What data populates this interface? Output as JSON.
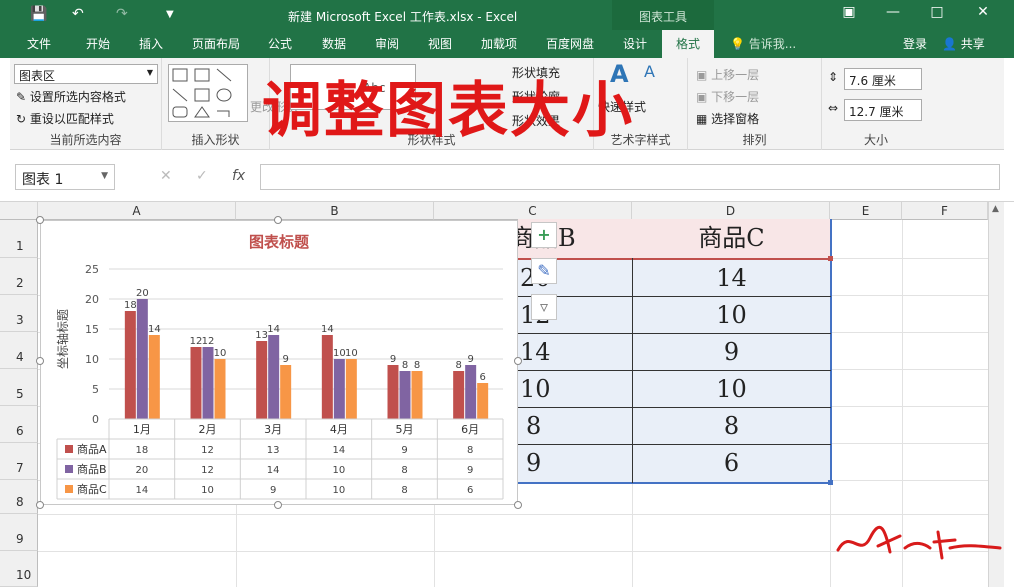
{
  "titlebar": {
    "title": "新建 Microsoft Excel 工作表.xlsx - Excel",
    "context_tab": "图表工具",
    "save_icon": "save-icon",
    "undo_icon": "undo-icon",
    "redo_icon": "redo-icon"
  },
  "tabs": [
    {
      "label": "文件"
    },
    {
      "label": "开始"
    },
    {
      "label": "插入"
    },
    {
      "label": "页面布局"
    },
    {
      "label": "公式"
    },
    {
      "label": "数据"
    },
    {
      "label": "审阅"
    },
    {
      "label": "视图"
    },
    {
      "label": "加载项"
    },
    {
      "label": "百度网盘"
    },
    {
      "label": "设计"
    },
    {
      "label": "格式"
    }
  ],
  "tell_me": "告诉我...",
  "login": "登录",
  "share": "共享",
  "ribbon": {
    "current_selection": {
      "combo_value": "图表区",
      "format_selection": "设置所选内容格式",
      "reset_style": "重设以匹配样式",
      "label": "当前所选内容"
    },
    "insert_shapes": {
      "label": "插入形状",
      "change_shape": "更改形状"
    },
    "shape_styles": {
      "label": "形状样式",
      "fill": "形状填充",
      "outline": "形状轮廓",
      "effects": "形状效果",
      "sample": "Abc"
    },
    "art_styles": {
      "label": "艺术字样式",
      "quick": "快速样式"
    },
    "arrange": {
      "label": "排列",
      "bring_forward": "上移一层",
      "send_backward": "下移一层",
      "selection_pane": "选择窗格"
    },
    "size": {
      "label": "大小",
      "height": "7.6 厘米",
      "width": "12.7 厘米"
    }
  },
  "formula_bar": {
    "name_box": "图表 1",
    "fx": "fx",
    "cancel": "✕",
    "enter": "✓"
  },
  "columns": [
    "A",
    "B",
    "C",
    "D",
    "E",
    "F"
  ],
  "rows": [
    "1",
    "2",
    "3",
    "4",
    "5",
    "6",
    "7",
    "8",
    "9",
    "10"
  ],
  "table": {
    "header_b": "商品B",
    "header_c": "商品C",
    "col_b": [
      "20",
      "12",
      "14",
      "10",
      "8",
      "9"
    ],
    "col_c": [
      "14",
      "10",
      "9",
      "10",
      "8",
      "6"
    ]
  },
  "overlay_caption": "调整图表大小",
  "chart_data": {
    "type": "bar",
    "title": "图表标题",
    "ylabel": "坐标轴标题",
    "xlabel": "",
    "ylim": [
      0,
      25
    ],
    "yticks": [
      "0",
      "5",
      "10",
      "15",
      "20",
      "25"
    ],
    "categories": [
      "1月",
      "2月",
      "3月",
      "4月",
      "5月",
      "6月"
    ],
    "series": [
      {
        "name": "商品A",
        "values": [
          18,
          12,
          13,
          14,
          9,
          8
        ],
        "color": "#c0504d"
      },
      {
        "name": "商品B",
        "values": [
          20,
          12,
          14,
          10,
          8,
          9
        ],
        "color": "#8064a2"
      },
      {
        "name": "商品C",
        "values": [
          14,
          10,
          9,
          10,
          8,
          6
        ],
        "color": "#f79646"
      }
    ],
    "data_table": true
  },
  "signature": "冬之峰"
}
